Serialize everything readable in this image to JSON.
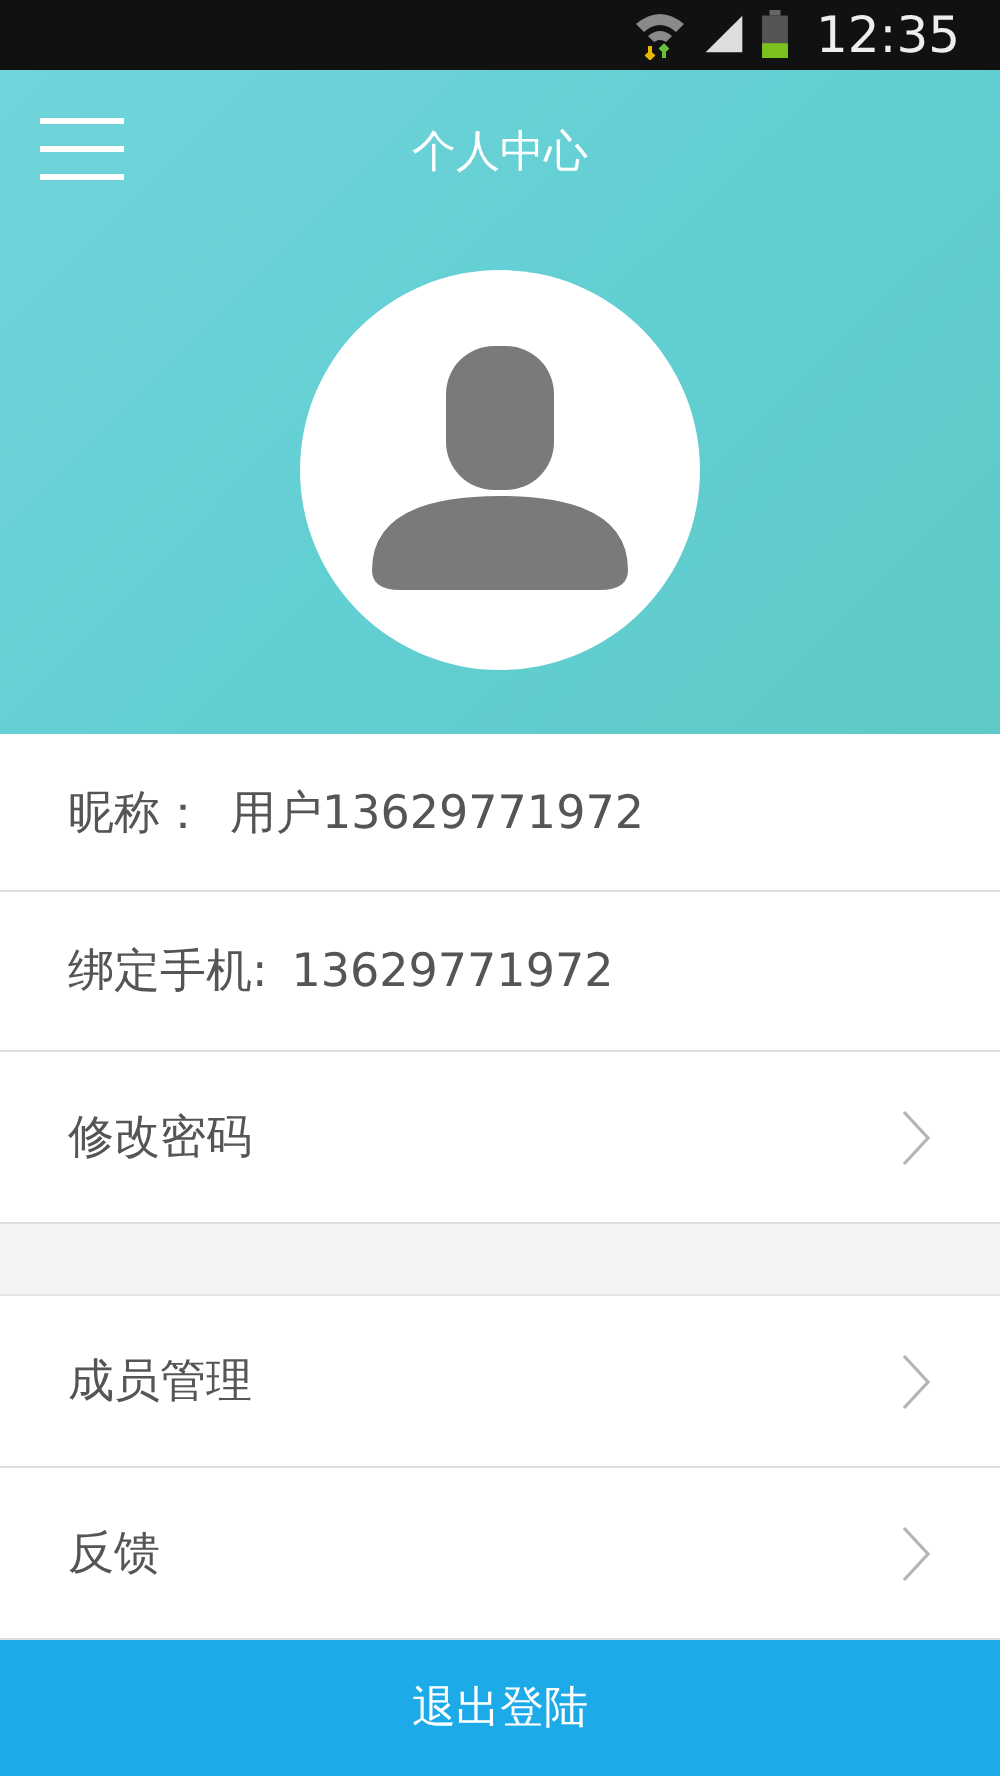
{
  "status_bar": {
    "time": "12:35"
  },
  "header": {
    "title": "个人中心"
  },
  "sections": [
    {
      "rows": [
        {
          "kind": "info",
          "label": "昵称：",
          "value": "用户13629771972"
        },
        {
          "kind": "info",
          "label": "绑定手机:",
          "value": "13629771972"
        },
        {
          "kind": "link",
          "label": "修改密码"
        }
      ]
    },
    {
      "rows": [
        {
          "kind": "link",
          "label": "成员管理"
        },
        {
          "kind": "link",
          "label": "反馈"
        }
      ]
    }
  ],
  "logout_button": "退出登陆"
}
